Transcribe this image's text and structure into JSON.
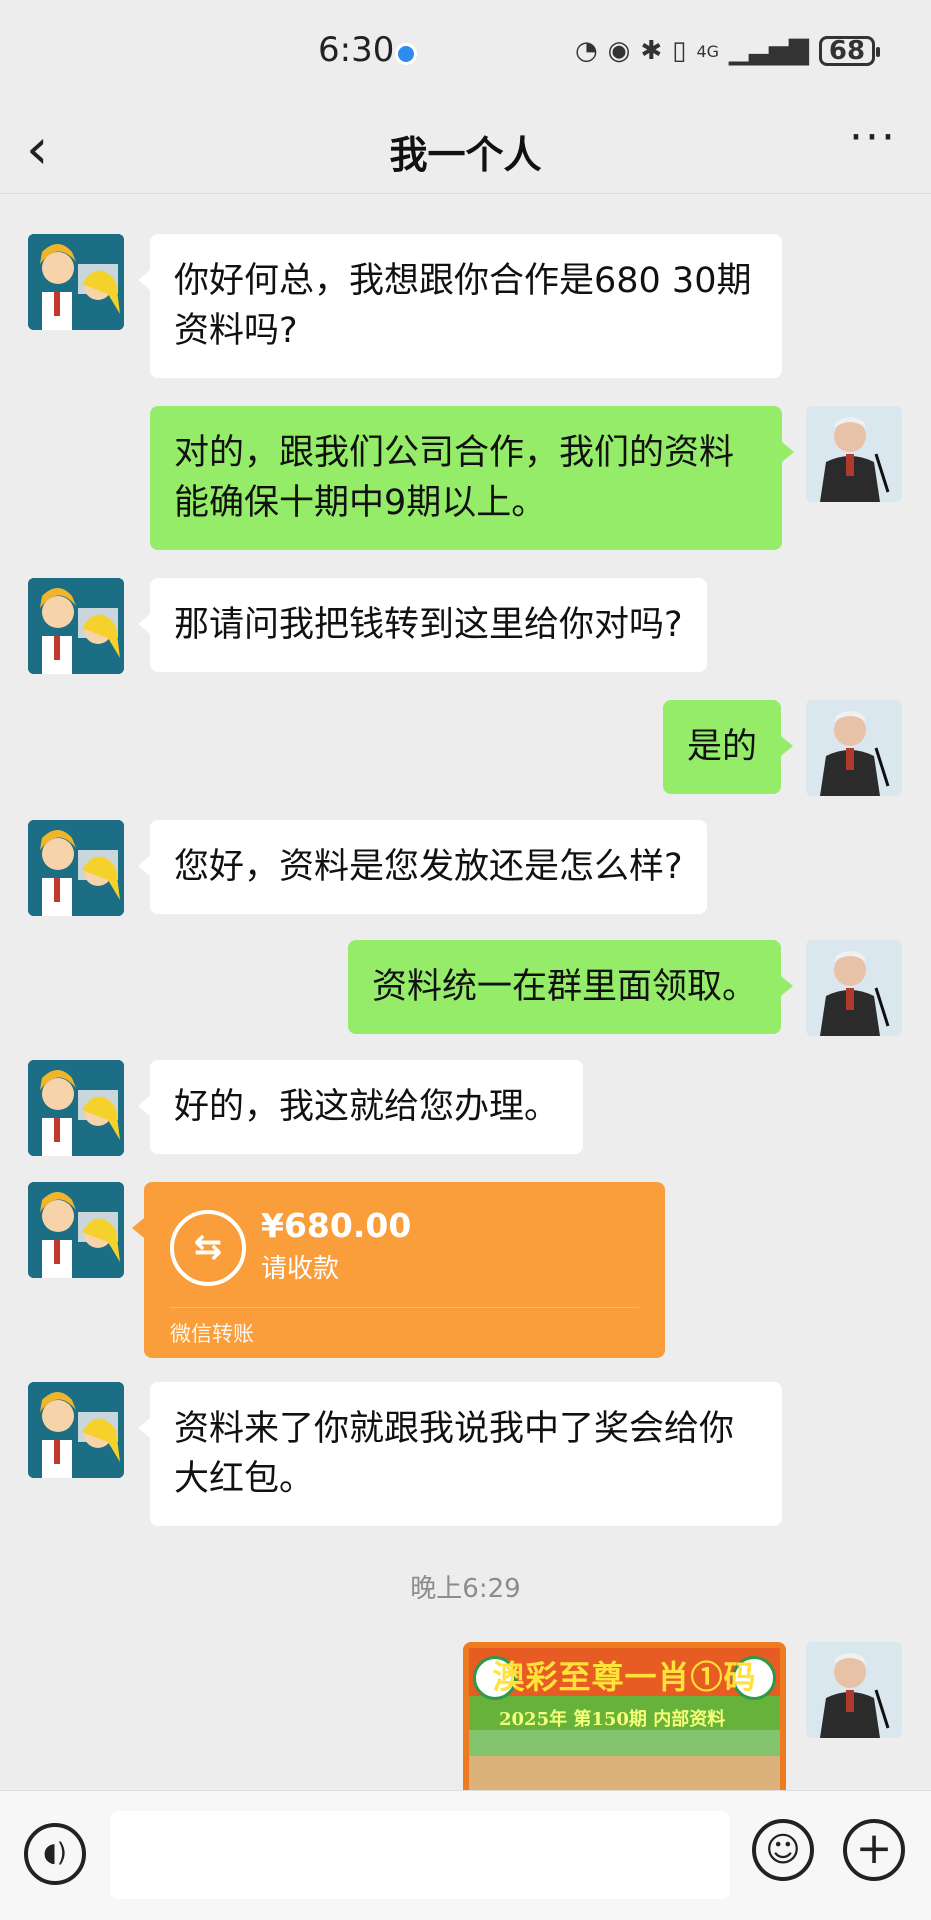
{
  "status_bar": {
    "time": "6:30",
    "battery": "68",
    "signal_label": "4G"
  },
  "header": {
    "back_icon": "chevron-left-icon",
    "title": "我一个人",
    "more_icon": "more-dots-icon",
    "more_glyph": "···"
  },
  "messages": [
    {
      "side": "left",
      "text": "你好何总，我想跟你合作是680 30期资料吗?"
    },
    {
      "side": "right",
      "text": "对的，跟我们公司合作，我们的资料能确保十期中9期以上。"
    },
    {
      "side": "left",
      "text": "那请问我把钱转到这里给你对吗?"
    },
    {
      "side": "right",
      "text": "是的"
    },
    {
      "side": "left",
      "text": "您好，资料是您发放还是怎么样?"
    },
    {
      "side": "right",
      "text": "资料统一在群里面领取。"
    },
    {
      "side": "left",
      "text": "好的，我这就给您办理。"
    },
    {
      "side": "left",
      "text": "资料来了你就跟我说我中了奖会给你大红包。"
    }
  ],
  "transfer": {
    "amount": "¥680.00",
    "status": "请收款",
    "label": "微信转账",
    "icon": "transfer-arrows-icon",
    "icon_glyph": "⇆"
  },
  "timestamp": "晚上6:29",
  "image_message": {
    "banner_text": "澳彩至尊一肖①码",
    "subline": "2025年 第150期 内部资料"
  },
  "input_bar": {
    "voice_icon": "voice-icon",
    "voice_glyph": "◖)",
    "emoji_icon": "emoji-icon",
    "emoji_glyph": "☺",
    "plus_icon": "plus-icon",
    "plus_glyph": "+",
    "input_value": ""
  }
}
